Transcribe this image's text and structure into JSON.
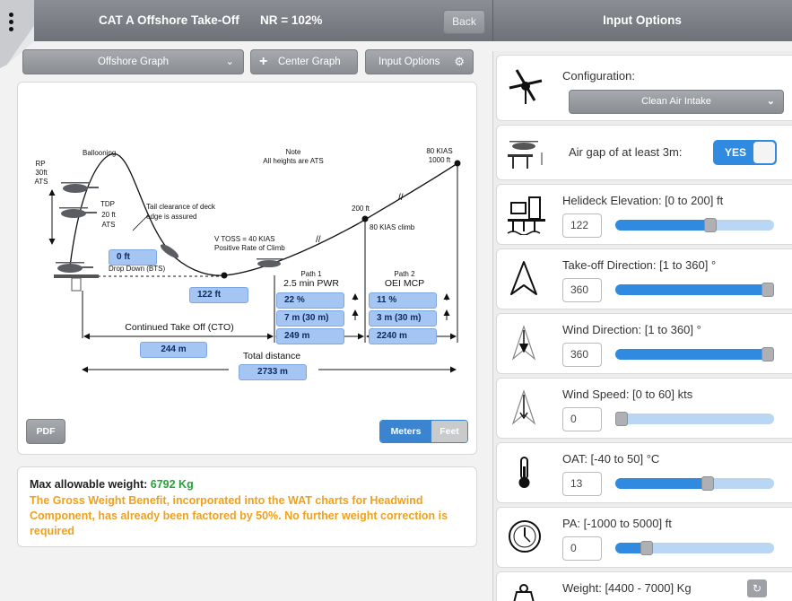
{
  "header": {
    "title": "CAT A Offshore Take-Off",
    "nr": "NR = 102%",
    "back_label": "Back",
    "right_title": "Input Options"
  },
  "toolbar": {
    "graph_select": "Offshore Graph",
    "center_label": "Center Graph",
    "input_options_label": "Input Options"
  },
  "graph": {
    "labels": {
      "ballooning": "Ballooning",
      "note": "Note",
      "note2": "All heights are ATS",
      "kias80_top": "80 KIAS",
      "ft1000": "1000 ft",
      "rp": "RP",
      "rp_30ft": "30ft",
      "rp_ats": "ATS",
      "tdp": "TDP",
      "tdp_20ft": "20 ft",
      "tdp_ats": "ATS",
      "tail1": "Tail clearance of deck",
      "tail2": "edge is assured",
      "ft200": "200 ft",
      "kias_climb": "80 KIAS climb",
      "vtoss": "V TOSS = 40 KIAS",
      "positive": "Positive Rate of Climb",
      "drop_down": "Drop Down (BTS)",
      "path1_small": "Path 1",
      "path1": "2.5 min PWR",
      "path2_small": "Path 2",
      "path2": "OEI MCP",
      "cto": "Continued Take Off (CTO)",
      "total": "Total distance"
    },
    "values": {
      "drop_down": "0 ft",
      "min_height": "122 ft",
      "path1_gradient": "22 %",
      "path1_height": "7 m (30 m)",
      "path1_distance": "249 m",
      "path2_gradient": "11 %",
      "path2_height": "3 m (30 m)",
      "path2_distance": "2240 m",
      "cto_distance": "244 m",
      "total_distance": "2733 m"
    },
    "pdf_label": "PDF",
    "units": {
      "active": "Meters",
      "inactive": "Feet"
    }
  },
  "weight": {
    "label": "Max allowable weight:",
    "value": "6792 Kg",
    "note": "The Gross Weight Benefit, incorporated into the WAT charts for Headwind Component, has already been factored by 50%. No further weight correction is required"
  },
  "inputs": {
    "configuration": {
      "label": "Configuration:",
      "value": "Clean Air Intake"
    },
    "air_gap": {
      "label": "Air gap of at least 3m:",
      "value": "YES"
    },
    "helideck_elevation": {
      "label": "Helideck Elevation: [0 to 200] ft",
      "value": "122",
      "level": 0.61
    },
    "takeoff_direction": {
      "label": "Take-off Direction: [1 to 360] °",
      "value": "360",
      "level": 1.0
    },
    "wind_direction": {
      "label": "Wind Direction: [1 to 360] °",
      "value": "360",
      "level": 1.0
    },
    "wind_speed": {
      "label": "Wind Speed: [0 to 60] kts",
      "value": "0",
      "level": 0.0
    },
    "oat": {
      "label": "OAT: [-40 to 50] °C",
      "value": "13",
      "level": 0.59
    },
    "pa": {
      "label": "PA: [-1000 to 5000] ft",
      "value": "0",
      "level": 0.17
    },
    "weight": {
      "label": "Weight: [4400 - 7000] Kg"
    }
  },
  "colors": {
    "accent": "#2f8ae0",
    "value_box": "#a5c5f2",
    "success": "#21a536",
    "warning": "#f0a11c"
  }
}
